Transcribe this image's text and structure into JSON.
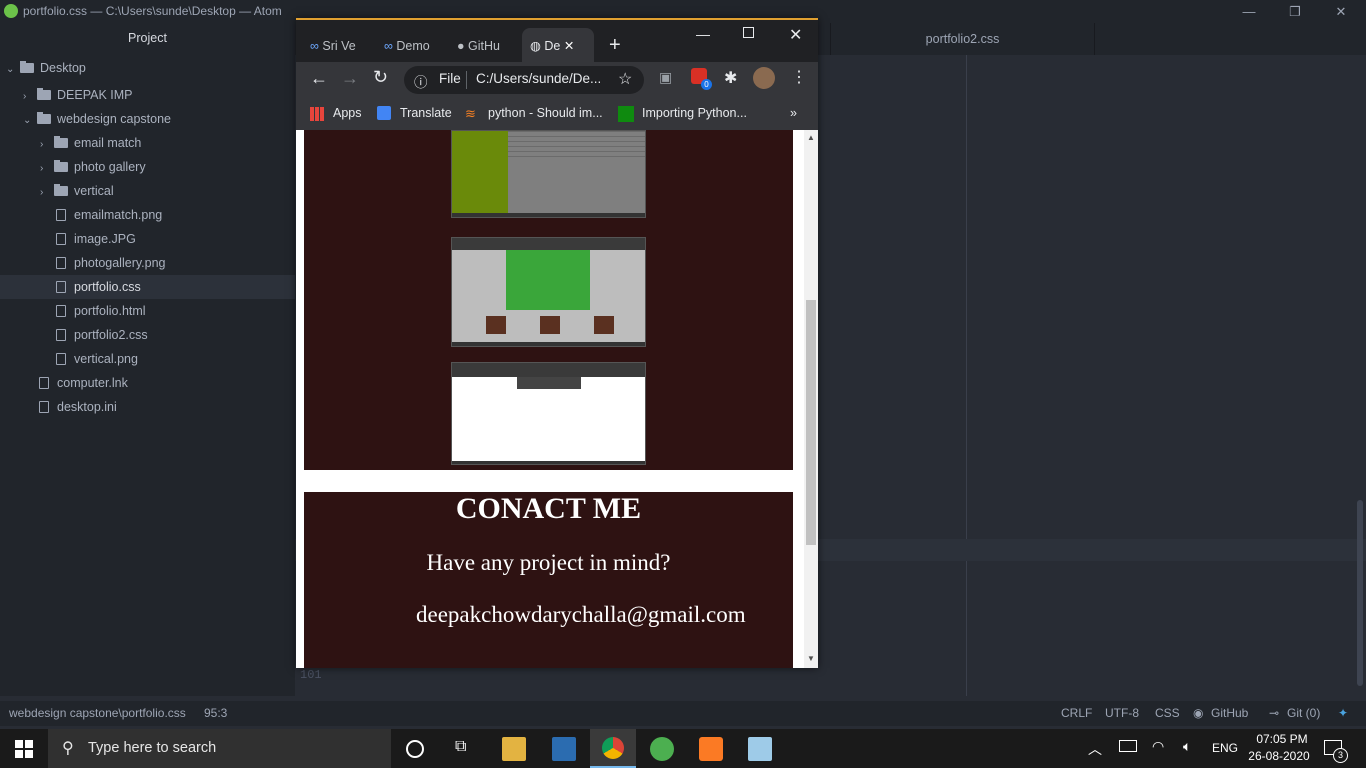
{
  "atom": {
    "window_title": "portfolio.css — C:\\Users\\sunde\\Desktop — Atom",
    "tree_header": "Project",
    "tree": [
      {
        "label": "Desktop",
        "kind": "folder",
        "expanded": true
      },
      {
        "label": "DEEPAK IMP",
        "kind": "folder",
        "expanded": false
      },
      {
        "label": "webdesign capstone",
        "kind": "folder",
        "expanded": true
      },
      {
        "label": "email match",
        "kind": "folder",
        "expanded": false
      },
      {
        "label": "photo gallery",
        "kind": "folder",
        "expanded": false
      },
      {
        "label": "vertical",
        "kind": "folder",
        "expanded": false
      },
      {
        "label": "emailmatch.png",
        "kind": "image"
      },
      {
        "label": "image.JPG",
        "kind": "image"
      },
      {
        "label": "photogallery.png",
        "kind": "image"
      },
      {
        "label": "portfolio.css",
        "kind": "file",
        "selected": true
      },
      {
        "label": "portfolio.html",
        "kind": "file"
      },
      {
        "label": "portfolio2.css",
        "kind": "file"
      },
      {
        "label": "vertical.png",
        "kind": "image"
      },
      {
        "label": "computer.lnk",
        "kind": "file"
      },
      {
        "label": "desktop.ini",
        "kind": "file"
      }
    ],
    "editor_tab": "portfolio2.css",
    "gutter_line": "101",
    "status": {
      "path": "webdesign capstone\\portfolio.css",
      "cursor": "95:3",
      "line_ending": "CRLF",
      "encoding": "UTF-8",
      "grammar": "CSS",
      "github": "GitHub",
      "git": "Git (0)"
    }
  },
  "chrome": {
    "tabs": [
      "Sri Ve",
      "Demo",
      "GitHu",
      "De"
    ],
    "new_tab": "+",
    "omnibox_scheme": "File",
    "omnibox_url": "C:/Users/sunde/De...",
    "bookmarks": [
      "Apps",
      "Translate",
      "python - Should im...",
      "Importing Python..."
    ],
    "bookmarks_more": "»",
    "extension_badge": "0"
  },
  "page": {
    "contact_title": "CONACT ME",
    "contact_question": "Have any project in mind?",
    "contact_email": "deepakchowdarychalla@gmail.com",
    "maroon": "#2e1212"
  },
  "taskbar": {
    "search_placeholder": "Type here to search",
    "language": "ENG",
    "time": "07:05 PM",
    "date": "26-08-2020",
    "notification_count": "3"
  }
}
